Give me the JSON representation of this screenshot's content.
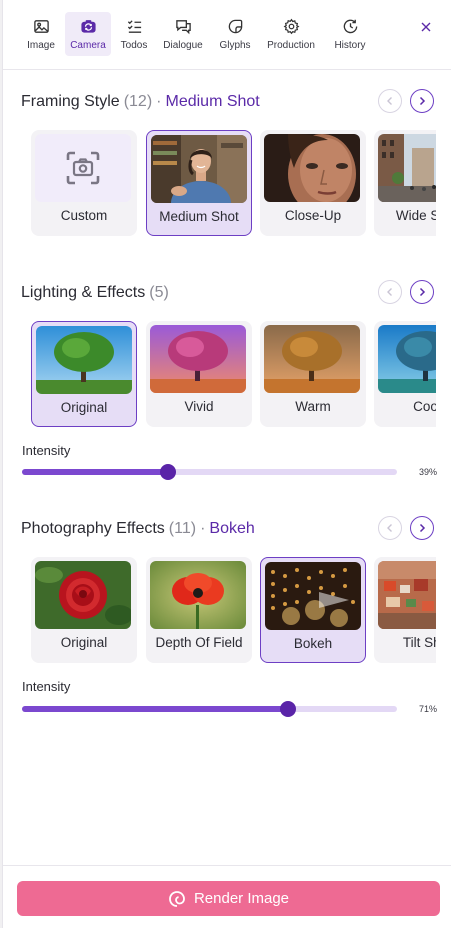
{
  "tabs": [
    {
      "label": "Image",
      "icon": "image-icon",
      "active": false
    },
    {
      "label": "Camera",
      "icon": "camera-icon",
      "active": true
    },
    {
      "label": "Todos",
      "icon": "checklist-icon",
      "active": false
    },
    {
      "label": "Dialogue",
      "icon": "chat-bubbles-icon",
      "active": false
    },
    {
      "label": "Glyphs",
      "icon": "sticker-icon",
      "active": false
    },
    {
      "label": "Production",
      "icon": "gear-icon",
      "active": false
    },
    {
      "label": "History",
      "icon": "history-icon",
      "active": false
    }
  ],
  "close_icon": "close-icon",
  "framing": {
    "title": "Framing Style",
    "count": "(12)",
    "separator": "·",
    "selected": "Medium Shot",
    "items": [
      {
        "label": "Custom",
        "thumb": "custom-camera-icon",
        "selected": false
      },
      {
        "label": "Medium Shot",
        "thumb": "woman-portrait-photo",
        "selected": true
      },
      {
        "label": "Close-Up",
        "thumb": "face-closeup-photo",
        "selected": false
      },
      {
        "label": "Wide Shot",
        "thumb": "city-street-photo",
        "selected": false
      }
    ]
  },
  "lighting": {
    "title": "Lighting & Effects",
    "count": "(5)",
    "items": [
      {
        "label": "Original",
        "thumb": "tree-natural-photo",
        "selected": true
      },
      {
        "label": "Vivid",
        "thumb": "tree-vivid-photo",
        "selected": false
      },
      {
        "label": "Warm",
        "thumb": "tree-warm-photo",
        "selected": false
      },
      {
        "label": "Cool",
        "thumb": "tree-cool-photo",
        "selected": false
      }
    ],
    "intensity_label": "Intensity",
    "intensity_value": "39%",
    "intensity": 0.39
  },
  "photography": {
    "title": "Photography Effects",
    "count": "(11)",
    "separator": "·",
    "selected": "Bokeh",
    "items": [
      {
        "label": "Original",
        "thumb": "rose-photo",
        "selected": false
      },
      {
        "label": "Depth Of Field",
        "thumb": "poppy-photo",
        "selected": false
      },
      {
        "label": "Bokeh",
        "thumb": "bokeh-lights-photo",
        "selected": true
      },
      {
        "label": "Tilt Shift",
        "thumb": "tilt-shift-town-photo",
        "selected": false
      }
    ],
    "intensity_label": "Intensity",
    "intensity_value": "71%",
    "intensity": 0.71
  },
  "footer": {
    "render_label": "Render Image",
    "render_icon": "swirl-icon"
  },
  "colors": {
    "accent": "#5b2aa8",
    "slider_fill": "#7b48cf",
    "slider_track": "#e3d8f5",
    "render_button": "#ee6a93"
  }
}
